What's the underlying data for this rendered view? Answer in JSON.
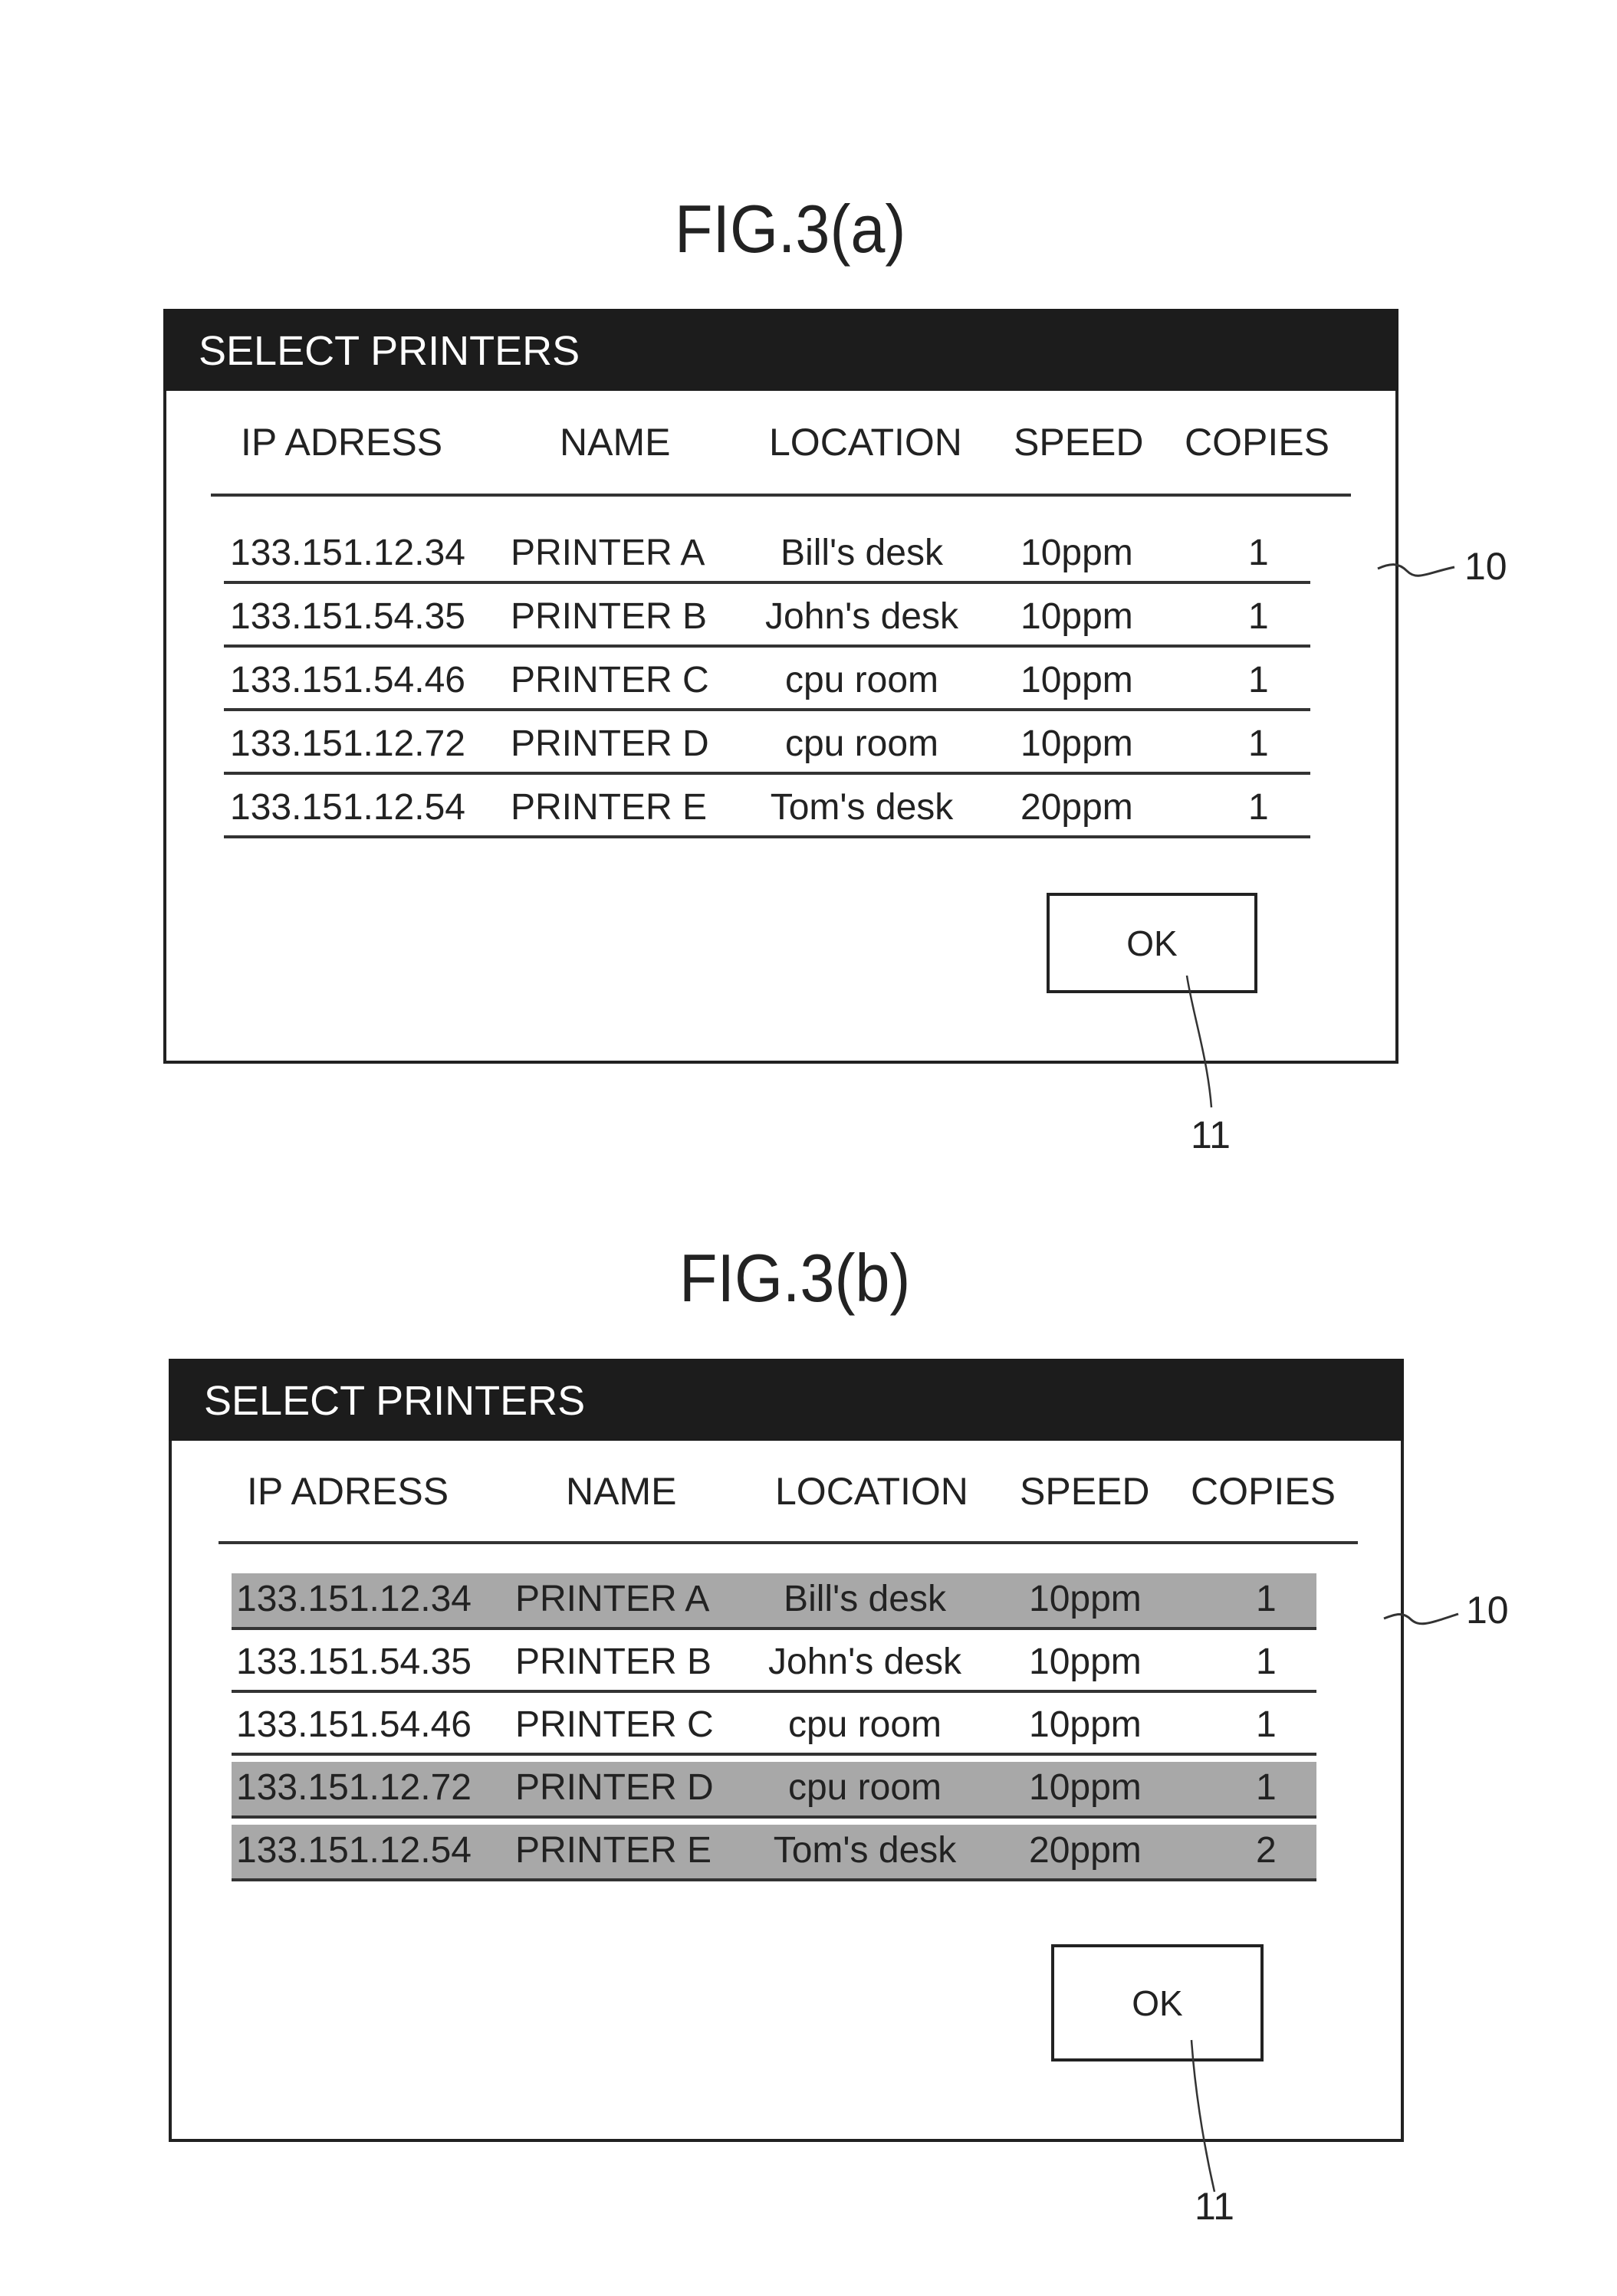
{
  "figures": [
    {
      "label": "FIG.3(a)",
      "dialog": {
        "title": "SELECT PRINTERS",
        "columns": [
          "IP ADRESS",
          "NAME",
          "LOCATION",
          "SPEED",
          "COPIES"
        ],
        "rows": [
          {
            "ip": "133.151.12.34",
            "name": "PRINTER A",
            "location": "Bill's desk",
            "speed": "10ppm",
            "copies": "1",
            "selected": false
          },
          {
            "ip": "133.151.54.35",
            "name": "PRINTER B",
            "location": "John's desk",
            "speed": "10ppm",
            "copies": "1",
            "selected": false
          },
          {
            "ip": "133.151.54.46",
            "name": "PRINTER C",
            "location": "cpu room",
            "speed": "10ppm",
            "copies": "1",
            "selected": false
          },
          {
            "ip": "133.151.12.72",
            "name": "PRINTER D",
            "location": "cpu room",
            "speed": "10ppm",
            "copies": "1",
            "selected": false
          },
          {
            "ip": "133.151.12.54",
            "name": "PRINTER E",
            "location": "Tom's desk",
            "speed": "20ppm",
            "copies": "1",
            "selected": false
          }
        ],
        "ok_label": "OK"
      },
      "ref_dialog": "10",
      "ref_ok": "11"
    },
    {
      "label": "FIG.3(b)",
      "dialog": {
        "title": "SELECT PRINTERS",
        "columns": [
          "IP ADRESS",
          "NAME",
          "LOCATION",
          "SPEED",
          "COPIES"
        ],
        "rows": [
          {
            "ip": "133.151.12.34",
            "name": "PRINTER A",
            "location": "Bill's desk",
            "speed": "10ppm",
            "copies": "1",
            "selected": true
          },
          {
            "ip": "133.151.54.35",
            "name": "PRINTER B",
            "location": "John's desk",
            "speed": "10ppm",
            "copies": "1",
            "selected": false
          },
          {
            "ip": "133.151.54.46",
            "name": "PRINTER C",
            "location": "cpu room",
            "speed": "10ppm",
            "copies": "1",
            "selected": false
          },
          {
            "ip": "133.151.12.72",
            "name": "PRINTER D",
            "location": "cpu room",
            "speed": "10ppm",
            "copies": "1",
            "selected": true
          },
          {
            "ip": "133.151.12.54",
            "name": "PRINTER E",
            "location": "Tom's desk",
            "speed": "20ppm",
            "copies": "2",
            "selected": true
          }
        ],
        "ok_label": "OK"
      },
      "ref_dialog": "10",
      "ref_ok": "11"
    }
  ],
  "colors": {
    "titlebar": "#1c1c1c",
    "selected_row": "#a8a8a8"
  }
}
